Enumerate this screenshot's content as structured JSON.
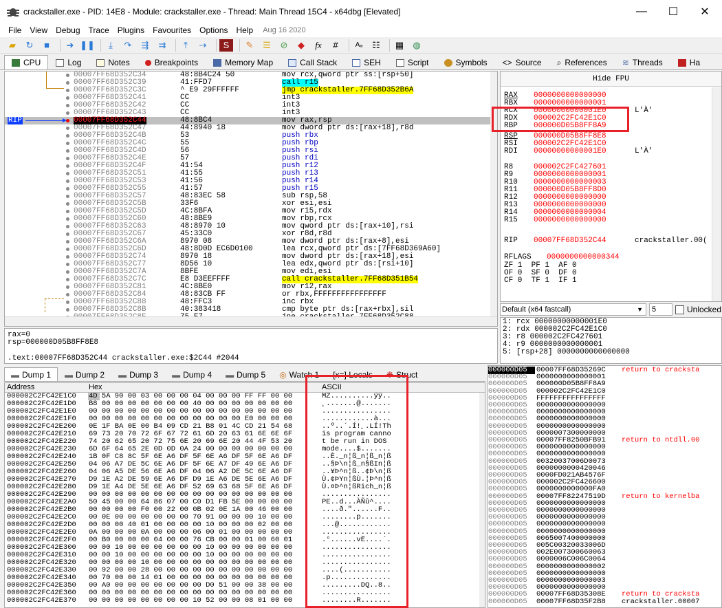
{
  "window": {
    "title": "crackstaller.exe - PID: 14E8 - Module: crackstaller.exe - Thread: Main Thread 15C4 - x64dbg [Elevated]",
    "min_glyph": "—",
    "max_glyph": "☐",
    "close_glyph": "✕"
  },
  "menu": [
    "File",
    "View",
    "Debug",
    "Trace",
    "Plugins",
    "Favourites",
    "Options",
    "Help"
  ],
  "menu_date": "Aug 16 2020",
  "toolbar_icons": [
    "open-icon",
    "restart-icon",
    "stop-icon",
    "run-icon",
    "pause-icon",
    "step-into-icon",
    "step-over-icon",
    "trace-into-icon",
    "trace-over-icon",
    "execute-till-return-icon",
    "run-to-user-code-icon",
    "scylla-icon",
    "patch-icon",
    "comment-icon",
    "label-icon",
    "bookmark-icon",
    "function-icon",
    "hash-icon",
    "font-icon",
    "list-icon",
    "calculator-icon",
    "globe-icon"
  ],
  "tabs": [
    "CPU",
    "Log",
    "Notes",
    "Breakpoints",
    "Memory Map",
    "Call Stack",
    "SEH",
    "Script",
    "Symbols",
    "Source",
    "References",
    "Threads",
    "Ha"
  ],
  "disasm": {
    "rip_label": "RIP",
    "rows": [
      {
        "addr": "00007FF68D352C34",
        "bytes": "48:8B4C24 50",
        "instr": "mov rcx,qword ptr ss:[rsp+50]"
      },
      {
        "addr": "00007FF68D352C39",
        "bytes": "41:FFD7",
        "instr": "call r15",
        "hl": "call"
      },
      {
        "addr": "00007FF68D352C3C",
        "bytes": "^ E9 29FFFFFF",
        "instr": "jmp crackstaller.7FF68D352B6A",
        "hl": "jmp"
      },
      {
        "addr": "00007FF68D352C41",
        "bytes": "CC",
        "instr": "int3"
      },
      {
        "addr": "00007FF68D352C42",
        "bytes": "CC",
        "instr": "int3"
      },
      {
        "addr": "00007FF68D352C43",
        "bytes": "CC",
        "instr": "int3"
      },
      {
        "addr": "00007FF68D352C44",
        "bytes": "48:8BC4",
        "instr": "mov rax,rsp",
        "rip": true
      },
      {
        "addr": "00007FF68D352C47",
        "bytes": "44:8940 18",
        "instr": "mov dword ptr ds:[rax+18],r8d"
      },
      {
        "addr": "00007FF68D352C4B",
        "bytes": "53",
        "instr": "push rbx",
        "push": true
      },
      {
        "addr": "00007FF68D352C4C",
        "bytes": "55",
        "instr": "push rbp",
        "push": true
      },
      {
        "addr": "00007FF68D352C4D",
        "bytes": "56",
        "instr": "push rsi",
        "push": true
      },
      {
        "addr": "00007FF68D352C4E",
        "bytes": "57",
        "instr": "push rdi",
        "push": true
      },
      {
        "addr": "00007FF68D352C4F",
        "bytes": "41:54",
        "instr": "push r12",
        "push": true
      },
      {
        "addr": "00007FF68D352C51",
        "bytes": "41:55",
        "instr": "push r13",
        "push": true
      },
      {
        "addr": "00007FF68D352C53",
        "bytes": "41:56",
        "instr": "push r14",
        "push": true
      },
      {
        "addr": "00007FF68D352C55",
        "bytes": "41:57",
        "instr": "push r15",
        "push": true
      },
      {
        "addr": "00007FF68D352C57",
        "bytes": "48:83EC 58",
        "instr": "sub rsp,58"
      },
      {
        "addr": "00007FF68D352C5B",
        "bytes": "33F6",
        "instr": "xor esi,esi"
      },
      {
        "addr": "00007FF68D352C5D",
        "bytes": "4C:8BFA",
        "instr": "mov r15,rdx"
      },
      {
        "addr": "00007FF68D352C60",
        "bytes": "48:8BE9",
        "instr": "mov rbp,rcx"
      },
      {
        "addr": "00007FF68D352C63",
        "bytes": "48:8970 10",
        "instr": "mov qword ptr ds:[rax+10],rsi"
      },
      {
        "addr": "00007FF68D352C67",
        "bytes": "45:33C0",
        "instr": "xor r8d,r8d"
      },
      {
        "addr": "00007FF68D352C6A",
        "bytes": "8970 08",
        "instr": "mov dword ptr ds:[rax+8],esi"
      },
      {
        "addr": "00007FF68D352C6D",
        "bytes": "48:8D0D EC6D0100",
        "instr": "lea rcx,qword ptr ds:[7FF68D369A60]"
      },
      {
        "addr": "00007FF68D352C74",
        "bytes": "8970 18",
        "instr": "mov dword ptr ds:[rax+18],esi"
      },
      {
        "addr": "00007FF68D352C77",
        "bytes": "8D56 10",
        "instr": "lea edx,qword ptr ds:[rsi+10]"
      },
      {
        "addr": "00007FF68D352C7A",
        "bytes": "8BFE",
        "instr": "mov edi,esi"
      },
      {
        "addr": "00007FF68D352C7C",
        "bytes": "E8 D3EEFFFF",
        "instr": "call crackstaller.7FF68D351B54",
        "hl": "call2"
      },
      {
        "addr": "00007FF68D352C81",
        "bytes": "4C:8BE0",
        "instr": "mov r12,rax"
      },
      {
        "addr": "00007FF68D352C84",
        "bytes": "48:83CB FF",
        "instr": "or rbx,FFFFFFFFFFFFFFFF"
      },
      {
        "addr": "00007FF68D352C88",
        "bytes": "48:FFC3",
        "instr": "inc rbx"
      },
      {
        "addr": "00007FF68D352C8B",
        "bytes": "40:383418",
        "instr": "cmp byte ptr ds:[rax+rbx],sil"
      },
      {
        "addr": "00007FF68D352C8F",
        "bytes": "75 F7",
        "instr": "jne crackstaller.7FF68D352C88"
      }
    ]
  },
  "info": {
    "line1": "rax=0",
    "line2": "rsp=000000D05B8FF8E8",
    "line3": ".text:00007FF68D352C44 crackstaller.exe:$2C44 #2044"
  },
  "registers": {
    "hide_fpu": "Hide FPU",
    "rows": [
      {
        "n": "RAX",
        "v": "0000000000000000",
        "u": true
      },
      {
        "n": "RBX",
        "v": "0000000000000001"
      },
      {
        "n": "RCX",
        "v": "00000000000001E0",
        "x": "L'À'"
      },
      {
        "n": "RDX",
        "v": "000002C2FC42E1C0"
      },
      {
        "n": "RBP",
        "v": "000000D05B8FF8A9"
      },
      {
        "n": "RSP",
        "v": "000000D05B8FF8E8",
        "u": true
      },
      {
        "n": "RSI",
        "v": "000002C2FC42E1C0"
      },
      {
        "n": "RDI",
        "v": "00000000000001E0",
        "x": "L'À'"
      },
      {
        "n": "R8",
        "v": "000002C2FC427601"
      },
      {
        "n": "R9",
        "v": "0000000000000001"
      },
      {
        "n": "R10",
        "v": "0000000000000003"
      },
      {
        "n": "R11",
        "v": "000000D05B8FF8D0"
      },
      {
        "n": "R12",
        "v": "0000000000000000"
      },
      {
        "n": "R13",
        "v": "0000000000000000"
      },
      {
        "n": "R14",
        "v": "0000000000000004"
      },
      {
        "n": "R15",
        "v": "0000000000000000"
      },
      {
        "n": "RIP",
        "v": "00007FF68D352C44",
        "x": "crackstaller.00("
      },
      {
        "n": "RFLAGS",
        "v": "0000000000000344"
      }
    ],
    "flags": [
      "ZF 1  PF 1  AF 0",
      "OF 0  SF 0  DF 0",
      "CF 0  TF 1  IF 1"
    ]
  },
  "callconv": {
    "label": "Default (x64 fastcall)",
    "count": "5",
    "unlocked": "Unlocked"
  },
  "args": [
    "1: rcx 00000000000001E0",
    "2: rdx 000002C2FC42E1C0",
    "3: r8 000002C2FC427601",
    "4: r9 0000000000000001",
    "5: [rsp+28] 0000000000000000"
  ],
  "dump_tabs": [
    "Dump 1",
    "Dump 2",
    "Dump 3",
    "Dump 4",
    "Dump 5",
    "Watch 1",
    "[x=] Locals",
    "Struct"
  ],
  "dump": {
    "headers": [
      "Address",
      "Hex",
      "ASCII"
    ],
    "rows": [
      {
        "a": "000002C2FC42E1C0",
        "h": "4D 5A 90 00 03 00 00 00 04 00 00 00 FF FF 00 00",
        "s": "MZ..........ÿÿ.."
      },
      {
        "a": "000002C2FC42E1D0",
        "h": "B8 00 00 00 00 00 00 00 40 00 00 00 00 00 00 00",
        "s": "¸.......@......."
      },
      {
        "a": "000002C2FC42E1E0",
        "h": "00 00 00 00 00 00 00 00 00 00 00 00 00 00 00 00",
        "s": "................"
      },
      {
        "a": "000002C2FC42E1F0",
        "h": "00 00 00 00 00 00 00 00 00 00 00 00 E0 00 00 00",
        "s": "............à..."
      },
      {
        "a": "000002C2FC42E200",
        "h": "0E 1F BA 0E 00 B4 09 CD 21 B8 01 4C CD 21 54 68",
        "s": "..º..´.Í!¸.LÍ!Th"
      },
      {
        "a": "000002C2FC42E210",
        "h": "69 73 20 70 72 6F 67 72 61 6D 20 63 61 6E 6E 6F",
        "s": "is program canno"
      },
      {
        "a": "000002C2FC42E220",
        "h": "74 20 62 65 20 72 75 6E 20 69 6E 20 44 4F 53 20",
        "s": "t be run in DOS "
      },
      {
        "a": "000002C2FC42E230",
        "h": "6D 6F 64 65 2E 0D 0D 0A 24 00 00 00 00 00 00 00",
        "s": "mode....$......."
      },
      {
        "a": "000002C2FC42E240",
        "h": "1B 0F C8 8C 5F 6E A6 DF 5F 6E A6 DF 5F 6E A6 DF",
        "s": "..È._n¦ß_n¦ß_n¦ß"
      },
      {
        "a": "000002C2FC42E250",
        "h": "04 06 A7 DE 5C 6E A6 DF 5F 6E A7 DF 49 6E A6 DF",
        "s": "..§Þ\\n¦ß_n§ßIn¦ß"
      },
      {
        "a": "000002C2FC42E260",
        "h": "04 06 A5 DE 56 6E A6 DF 04 06 A2 DE 5C 6E A6 DF",
        "s": "..¥Þ^n¦ß..¢Þ\\n¦ß"
      },
      {
        "a": "000002C2FC42E270",
        "h": "D9 1E A2 DE 59 6E A6 DF D9 1E A6 DE 5E 6E A6 DF",
        "s": "Ù.¢ÞYn¦ßÙ.¦Þ^n¦ß"
      },
      {
        "a": "000002C2FC42E280",
        "h": "D9 1E A4 DE 5E 6E A6 DF 52 69 63 68 5F 6E A6 DF",
        "s": "Ù.¤Þ^n¦ßRich_n¦ß"
      },
      {
        "a": "000002C2FC42E290",
        "h": "00 00 00 00 00 00 00 00 00 00 00 00 00 00 00 00",
        "s": "................"
      },
      {
        "a": "000002C2FC42E2A0",
        "h": "50 45 00 00 64 86 07 00 C0 D1 FB 5E 00 00 00 00",
        "s": "PE..d...ÀÑû^...."
      },
      {
        "a": "000002C2FC42E2B0",
        "h": "00 00 00 00 F0 00 22 00 0B 02 0E 1A 00 46 00 00",
        "s": "....ð.\"......F.."
      },
      {
        "a": "000002C2FC42E2C0",
        "h": "00 0E 00 00 00 00 00 00 70 91 00 00 00 10 00 00",
        "s": "........p......."
      },
      {
        "a": "000002C2FC42E2D0",
        "h": "00 00 00 40 01 00 00 00 00 10 00 00 00 02 00 00",
        "s": "...@............"
      },
      {
        "a": "000002C2FC42E2E0",
        "h": "0A 00 00 00 0A 00 00 00 06 00 01 00 00 00 00 00",
        "s": "................"
      },
      {
        "a": "000002C2FC42E2F0",
        "h": "00 B0 00 00 00 04 00 00 76 CB 00 00 01 00 60 01",
        "s": ".°......vË....`."
      },
      {
        "a": "000002C2FC42E300",
        "h": "00 00 10 00 00 00 00 00 00 10 00 00 00 00 00 00",
        "s": "................"
      },
      {
        "a": "000002C2FC42E310",
        "h": "00 00 10 00 00 00 00 00 00 10 00 00 00 00 00 00",
        "s": "................"
      },
      {
        "a": "000002C2FC42E320",
        "h": "00 00 00 00 10 00 00 00 00 00 00 00 00 00 00 00",
        "s": "................"
      },
      {
        "a": "000002C2FC42E330",
        "h": "00 92 00 00 28 00 00 00 00 00 00 00 00 00 00 00",
        "s": "....(..........."
      },
      {
        "a": "000002C2FC42E340",
        "h": "00 70 00 00 14 01 00 00 00 00 00 00 00 00 00 00",
        "s": ".p.............."
      },
      {
        "a": "000002C2FC42E350",
        "h": "00 A0 00 00 00 00 00 00 00 D0 51 00 00 38 00 00",
        "s": ".........DQ..8.."
      },
      {
        "a": "000002C2FC42E360",
        "h": "00 00 00 00 00 00 00 00 00 00 00 00 00 00 00 00",
        "s": "................"
      },
      {
        "a": "000002C2FC42E370",
        "h": "00 00 00 00 00 00 00 00 10 52 00 00 08 01 00 00",
        "s": "........R......."
      }
    ]
  },
  "stack": {
    "rows": [
      {
        "a": "000000D05",
        "v": "00007FF68D35269C",
        "c": "return to cracksta",
        "top": true
      },
      {
        "a": "000000D05",
        "v": "0000000000000001"
      },
      {
        "a": "000000D05",
        "v": "000000D05B8FF8A9"
      },
      {
        "a": "000000D05",
        "v": "000002C2FC42E1C0"
      },
      {
        "a": "000000D05",
        "v": "FFFFFFFFFFFFFFFF"
      },
      {
        "a": "000000D05",
        "v": "0000000000000000"
      },
      {
        "a": "000000D05",
        "v": "0000000000000000"
      },
      {
        "a": "000000D05",
        "v": "0000000000000000"
      },
      {
        "a": "000000D05",
        "v": "0000000000000000"
      },
      {
        "a": "000000D05",
        "v": "0000007300000000"
      },
      {
        "a": "000000D05",
        "v": "00007FF8250BFB91",
        "c": "return to ntdll.00"
      },
      {
        "a": "000000D05",
        "v": "0000000000000000"
      },
      {
        "a": "000000D05",
        "v": "0000000000000000"
      },
      {
        "a": "000000D05",
        "v": "00320037006D0073"
      },
      {
        "a": "000000D05",
        "v": "0000000000420046"
      },
      {
        "a": "000000D05",
        "v": "0000FD021AB4576F"
      },
      {
        "a": "000000D05",
        "v": "000002C2FC426600"
      },
      {
        "a": "000000D05",
        "v": "0000000000000FA0"
      },
      {
        "a": "000000D05",
        "v": "00007FF82247519D",
        "c": "return to kernelba"
      },
      {
        "a": "000000D05",
        "v": "0000000000000000"
      },
      {
        "a": "000000D05",
        "v": "0000000000000000"
      },
      {
        "a": "000000D05",
        "v": "0000000000000000"
      },
      {
        "a": "000000D05",
        "v": "0000000000000000"
      },
      {
        "a": "000000D05",
        "v": "0000000000000000"
      },
      {
        "a": "000000D05",
        "v": "0065007400000000"
      },
      {
        "a": "000000D05",
        "v": "005C00320033006D"
      },
      {
        "a": "000000D05",
        "v": "002E007300660063"
      },
      {
        "a": "000000D05",
        "v": "0000006C006C0064"
      },
      {
        "a": "000000D05",
        "v": "0000000000000002"
      },
      {
        "a": "000000D05",
        "v": "0000000000000000"
      },
      {
        "a": "000000D05",
        "v": "0000000000000003"
      },
      {
        "a": "000000D05",
        "v": "0000000000000000"
      },
      {
        "a": "000000D05",
        "v": "00007FF68D35308E",
        "c": "return to cracksta"
      },
      {
        "a": "000000D05",
        "v": "00007FF68D35F2B8",
        "c": "crackstaller.00007",
        "black": true
      }
    ]
  }
}
